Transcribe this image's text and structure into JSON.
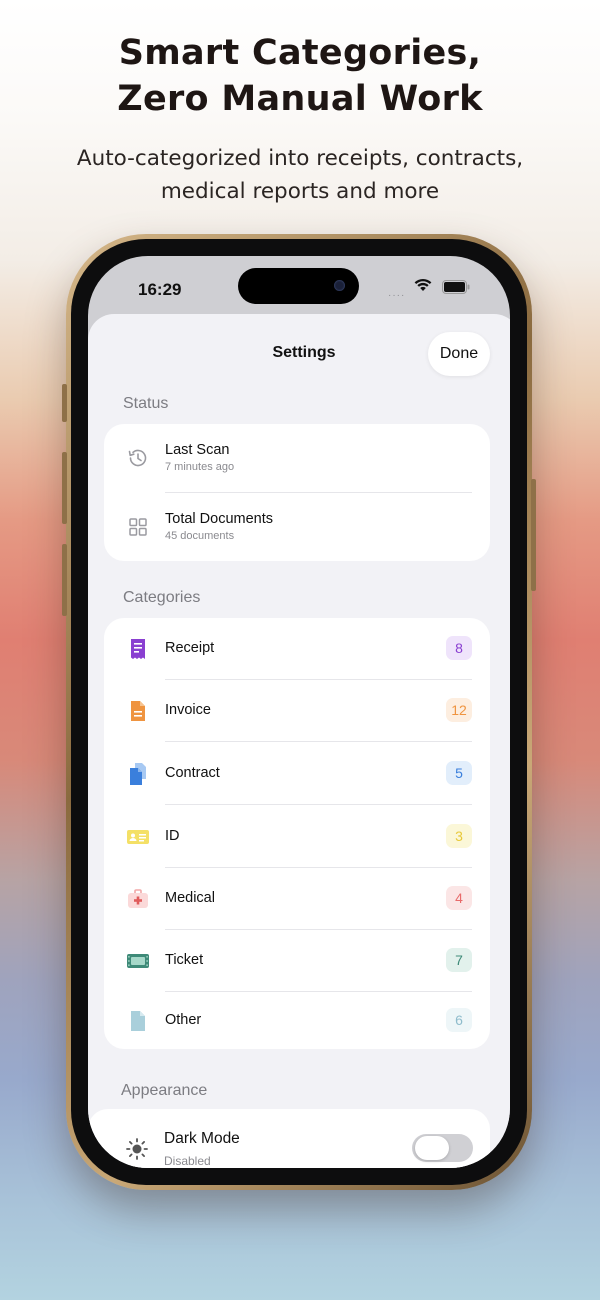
{
  "marketing": {
    "headline_line1": "Smart Categories,",
    "headline_line2": "Zero Manual Work",
    "subhead_line1": "Auto-categorized into receipts, contracts,",
    "subhead_line2": "medical reports and more"
  },
  "status_bar": {
    "time": "16:29",
    "signal": "····"
  },
  "settings": {
    "title": "Settings",
    "done_label": "Done",
    "status_section": {
      "header": "Status",
      "rows": [
        {
          "title": "Last Scan",
          "subtitle": "7 minutes ago",
          "icon": "clock-history-icon"
        },
        {
          "title": "Total Documents",
          "subtitle": "45 documents",
          "icon": "grid-icon"
        }
      ]
    },
    "categories_section": {
      "header": "Categories",
      "items": [
        {
          "label": "Receipt",
          "count": "8",
          "icon": "receipt-icon",
          "color": "#8a3fd1",
          "badge_bg": "#efe4fb"
        },
        {
          "label": "Invoice",
          "count": "12",
          "icon": "invoice-icon",
          "color": "#ef9440",
          "badge_bg": "#fdeee0"
        },
        {
          "label": "Contract",
          "count": "5",
          "icon": "contract-icon",
          "color": "#3a7fdc",
          "badge_bg": "#e2eefb"
        },
        {
          "label": "ID",
          "count": "3",
          "icon": "id-card-icon",
          "color": "#e8c93a",
          "badge_bg": "#fbf7d8"
        },
        {
          "label": "Medical",
          "count": "4",
          "icon": "medical-kit-icon",
          "color": "#e86a6a",
          "badge_bg": "#fbe6e6"
        },
        {
          "label": "Ticket",
          "count": "7",
          "icon": "ticket-icon",
          "color": "#3e8a78",
          "badge_bg": "#e2f1ec"
        },
        {
          "label": "Other",
          "count": "6",
          "icon": "document-icon",
          "color": "#8fbccc",
          "badge_bg": "#eef6f8"
        }
      ]
    },
    "appearance_section": {
      "header": "Appearance",
      "dark_mode_label": "Dark Mode",
      "dark_mode_status": "Disabled",
      "icon": "sun-icon"
    }
  }
}
